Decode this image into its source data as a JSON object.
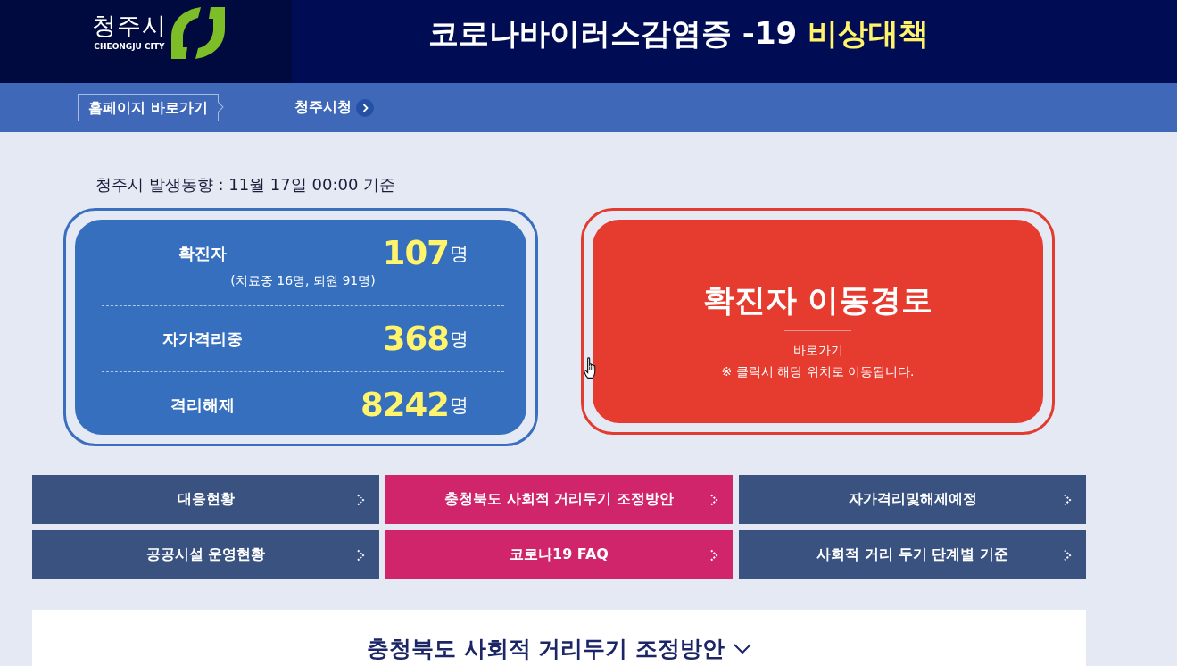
{
  "header": {
    "logo_text": "청주시",
    "logo_subtext": "CHEONGJU CITY",
    "title": "코로나바이러스감염증 -19",
    "title_highlight": "비상대책"
  },
  "nav": {
    "home_link": "홈페이지 바로가기",
    "links": [
      "청주시청"
    ]
  },
  "status_line": "청주시 발생동향 : 11월 17일 00:00 기준",
  "stats": [
    {
      "label": "확진자",
      "value": "107",
      "unit": "명",
      "note": "(치료중 16명, 퇴원 91명)"
    },
    {
      "label": "자가격리중",
      "value": "368",
      "unit": "명"
    },
    {
      "label": "격리해제",
      "value": "8242",
      "unit": "명"
    }
  ],
  "route_card": {
    "title": "확진자 이동경로",
    "link": "바로가기",
    "note": "※ 클릭시 해당 위치로 이동됩니다."
  },
  "menu": [
    {
      "label": "대응현황",
      "color": "#3a5280"
    },
    {
      "label": "충청북도 사회적 거리두기 조정방안",
      "color": "#d0256b"
    },
    {
      "label": "자가격리및해제예정",
      "color": "#3a5280"
    },
    {
      "label": "공공시설 운영현황",
      "color": "#3a5280"
    },
    {
      "label": "코로나19 FAQ",
      "color": "#d0256b"
    },
    {
      "label": "사회적 거리 두기 단계별 기준",
      "color": "#3a5280"
    }
  ],
  "section": {
    "title": "충청북도 사회적 거리두기 조정방안"
  }
}
